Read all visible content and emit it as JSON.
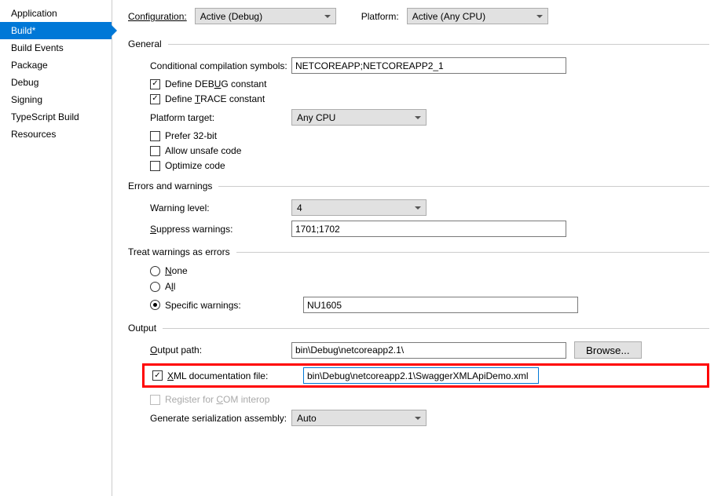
{
  "sidebar": {
    "items": [
      {
        "label": "Application"
      },
      {
        "label": "Build*"
      },
      {
        "label": "Build Events"
      },
      {
        "label": "Package"
      },
      {
        "label": "Debug"
      },
      {
        "label": "Signing"
      },
      {
        "label": "TypeScript Build"
      },
      {
        "label": "Resources"
      }
    ]
  },
  "top": {
    "config_label": "Configuration:",
    "config_value": "Active (Debug)",
    "platform_label": "Platform:",
    "platform_value": "Active (Any CPU)"
  },
  "sections": {
    "general": "General",
    "warnings": "Errors and warnings",
    "treat": "Treat warnings as errors",
    "output": "Output"
  },
  "general": {
    "ccs_label": "Conditional compilation symbols:",
    "ccs_value": "NETCOREAPP;NETCOREAPP2_1",
    "debug_html": "Define DEB<span class='u'>U</span>G constant",
    "trace_html": "Define <span class='u'>T</span>RACE constant",
    "platform_label": "Platform target:",
    "platform_value": "Any CPU",
    "prefer32": "Prefer 32-bit",
    "unsafe": "Allow unsafe code",
    "optimize": "Optimize code"
  },
  "warnings": {
    "level_label": "Warning level:",
    "level_value": "4",
    "suppress_label_html": "<span class='u'>S</span>uppress warnings:",
    "suppress_value": "1701;1702"
  },
  "treat": {
    "none_html": "<span class='u'>N</span>one",
    "all_html": "A<span class='u'>l</span>l",
    "specific": "Specific warnings:",
    "specific_value": "NU1605"
  },
  "output": {
    "path_label_html": "<span class='u'>O</span>utput path:",
    "path_value": "bin\\Debug\\netcoreapp2.1\\",
    "browse": "Browse...",
    "xml_label_html": "<span class='u'>X</span>ML documentation file:",
    "xml_value": "bin\\Debug\\netcoreapp2.1\\SwaggerXMLApiDemo.xml",
    "com_html": "Register for <span class='u'>C</span>OM interop",
    "gen_label": "Generate serialization assembly:",
    "gen_value": "Auto"
  }
}
